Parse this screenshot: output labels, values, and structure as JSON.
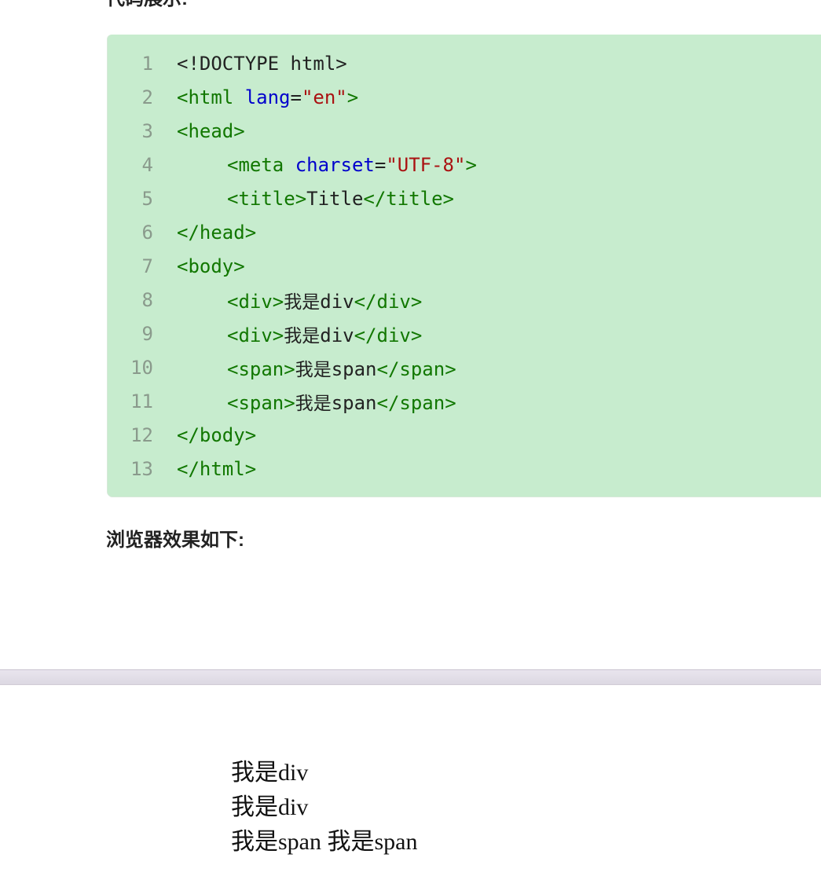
{
  "headings": {
    "top_partial": "代码展示:",
    "result": "浏览器效果如下:"
  },
  "code": {
    "lines": [
      {
        "num": "1",
        "doctype": "<!DOCTYPE html>"
      },
      {
        "num": "2",
        "open": "<html",
        "attr": "lang",
        "eq": "=",
        "val": "\"en\"",
        "close": ">"
      },
      {
        "num": "3",
        "tag": "<head>"
      },
      {
        "num": "4",
        "open": "<meta",
        "attr": "charset",
        "eq": "=",
        "val": "\"UTF-8\"",
        "close": ">"
      },
      {
        "num": "5",
        "open": "<title>",
        "text": "Title",
        "close": "</title>"
      },
      {
        "num": "6",
        "tag": "</head>"
      },
      {
        "num": "7",
        "tag": "<body>"
      },
      {
        "num": "8",
        "open": "<div>",
        "cjk": "我是",
        "text": "div",
        "close": "</div>"
      },
      {
        "num": "9",
        "open": "<div>",
        "cjk": "我是",
        "text": "div",
        "close": "</div>"
      },
      {
        "num": "10",
        "open": "<span>",
        "cjk": "我是",
        "text": "span",
        "close": "</span>"
      },
      {
        "num": "11",
        "open": "<span>",
        "cjk": "我是",
        "text": "span",
        "close": "</span>"
      },
      {
        "num": "12",
        "tag": "</body>"
      },
      {
        "num": "13",
        "tag": "</html>"
      }
    ]
  },
  "browser_output": {
    "lines": [
      "我是div",
      "我是div",
      "我是span 我是span"
    ]
  },
  "colors": {
    "code_background": "#c7ecce",
    "tag": "#117700",
    "attribute": "#0000cc",
    "string": "#aa1111",
    "line_number": "#8a9a8c"
  }
}
